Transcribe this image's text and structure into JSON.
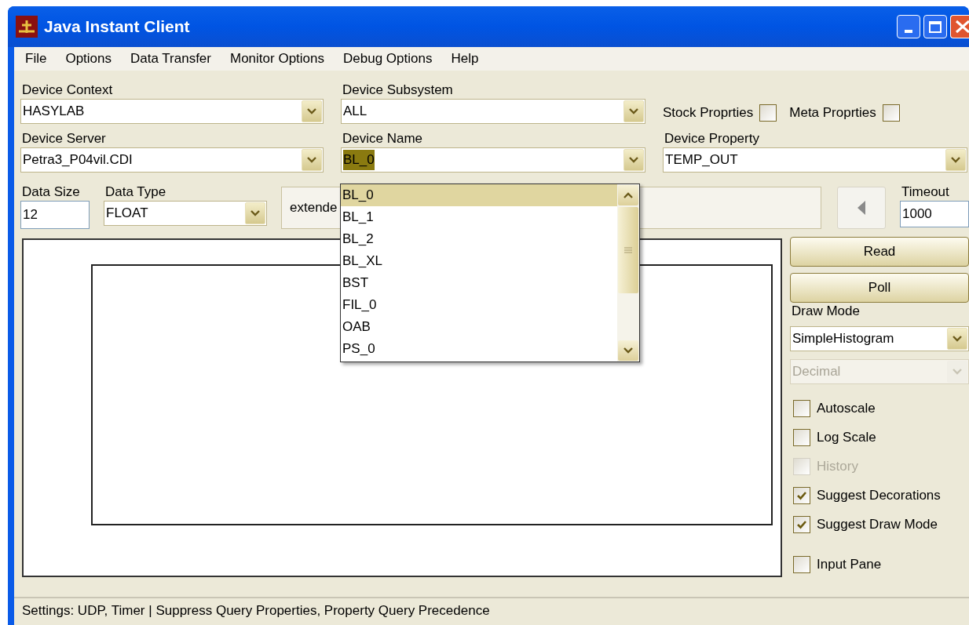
{
  "window": {
    "title": "Java Instant Client"
  },
  "menu": [
    "File",
    "Options",
    "Data Transfer",
    "Monitor Options",
    "Debug Options",
    "Help"
  ],
  "device_context": {
    "label": "Device Context",
    "value": "HASYLAB"
  },
  "device_subsystem": {
    "label": "Device Subsystem",
    "value": "ALL"
  },
  "stock_properties": {
    "label": "Stock Proprties",
    "checked": false
  },
  "meta_properties": {
    "label": "Meta Proprties",
    "checked": false
  },
  "device_server": {
    "label": "Device Server",
    "value": "Petra3_P04vil.CDI"
  },
  "device_name": {
    "label": "Device Name",
    "value": "BL_0",
    "text_selected": true,
    "expanded": true
  },
  "device_property": {
    "label": "Device Property",
    "value": "TEMP_OUT"
  },
  "data_size": {
    "label": "Data Size",
    "value": "12"
  },
  "data_type": {
    "label": "Data Type",
    "value": "FLOAT"
  },
  "info_field": {
    "value": "extende"
  },
  "timeout": {
    "label": "Timeout",
    "value": "1000"
  },
  "buttons": [
    "Read",
    "Poll"
  ],
  "draw_mode": {
    "label": "Draw Mode",
    "value": "SimpleHistogram",
    "disabled": false
  },
  "number_format": {
    "value": "Decimal",
    "disabled": true
  },
  "options": [
    {
      "label": "Autoscale",
      "checked": false,
      "disabled": false
    },
    {
      "label": "Log Scale",
      "checked": false,
      "disabled": false
    },
    {
      "label": "History",
      "checked": false,
      "disabled": true
    },
    {
      "label": "Suggest Decorations",
      "checked": true,
      "disabled": false
    },
    {
      "label": "Suggest Draw Mode",
      "checked": true,
      "disabled": false
    },
    {
      "label": "Input Pane",
      "checked": false,
      "disabled": false
    }
  ],
  "device_name_dropdown": [
    {
      "label": "BL_0",
      "selected": true
    },
    {
      "label": "BL_1",
      "selected": false
    },
    {
      "label": "BL_2",
      "selected": false
    },
    {
      "label": "BL_XL",
      "selected": false
    },
    {
      "label": "BST",
      "selected": false
    },
    {
      "label": "FIL_0",
      "selected": false
    },
    {
      "label": "OAB",
      "selected": false
    },
    {
      "label": "PS_0",
      "selected": false
    }
  ],
  "status_bar": "Settings: UDP, Timer | Suppress Query Properties, Property Query Precedence"
}
